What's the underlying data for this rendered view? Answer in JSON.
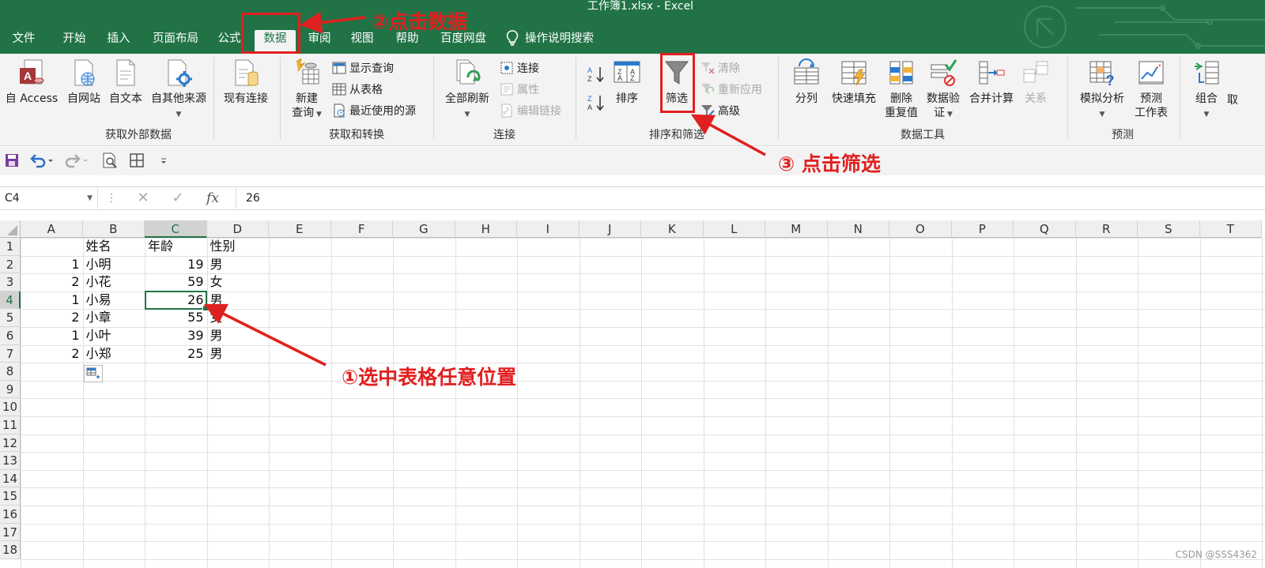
{
  "window": {
    "title": "工作簿1.xlsx  -  Excel"
  },
  "tabs": [
    {
      "label": "文件"
    },
    {
      "label": "开始"
    },
    {
      "label": "插入"
    },
    {
      "label": "页面布局"
    },
    {
      "label": "公式"
    },
    {
      "label": "数据",
      "active": true
    },
    {
      "label": "审阅"
    },
    {
      "label": "视图"
    },
    {
      "label": "帮助"
    },
    {
      "label": "百度网盘"
    },
    {
      "label": "操作说明搜索"
    }
  ],
  "ribbon": {
    "get_external": {
      "label": "获取外部数据",
      "from_access": "自 Access",
      "from_web": "自网站",
      "from_text": "自文本",
      "from_other": "自其他来源",
      "existing": "现有连接"
    },
    "get_transform": {
      "label": "获取和转换",
      "new_query_1": "新建",
      "new_query_2": "查询",
      "show_queries": "显示查询",
      "from_table": "从表格",
      "recent_sources": "最近使用的源"
    },
    "connections": {
      "label": "连接",
      "refresh_all": "全部刷新",
      "connections": "连接",
      "properties": "属性",
      "edit_links": "编辑链接"
    },
    "sort_filter": {
      "label": "排序和筛选",
      "sort": "排序",
      "filter": "筛选",
      "clear": "清除",
      "reapply": "重新应用",
      "advanced": "高级"
    },
    "data_tools": {
      "label": "数据工具",
      "text_to_cols": "分列",
      "flash_fill": "快速填充",
      "remove_dup_1": "删除",
      "remove_dup_2": "重复值",
      "validation_1": "数据验",
      "validation_2": "证",
      "consolidate": "合并计算",
      "relationships": "关系"
    },
    "forecast": {
      "label": "预测",
      "what_if": "模拟分析",
      "sheet_1": "预测",
      "sheet_2": "工作表"
    },
    "outline": {
      "group": "组合",
      "ungroup_partial": "取"
    }
  },
  "formula_bar": {
    "name_box": "C4",
    "fx": "fx",
    "value": "26"
  },
  "sheet": {
    "columns": [
      "A",
      "B",
      "C",
      "D",
      "E",
      "F",
      "G",
      "H",
      "I",
      "J",
      "K",
      "L",
      "M",
      "N",
      "O",
      "P",
      "Q",
      "R",
      "S",
      "T"
    ],
    "rows": [
      "1",
      "2",
      "3",
      "4",
      "5",
      "6",
      "7",
      "8",
      "9",
      "10",
      "11",
      "12",
      "13",
      "14",
      "15",
      "16",
      "17",
      "18"
    ],
    "header": {
      "b": "姓名",
      "c": "年龄",
      "d": "性别"
    },
    "data": [
      {
        "a": "1",
        "b": "小明",
        "c": "19",
        "d": "男"
      },
      {
        "a": "2",
        "b": "小花",
        "c": "59",
        "d": "女"
      },
      {
        "a": "1",
        "b": "小易",
        "c": "26",
        "d": "男"
      },
      {
        "a": "2",
        "b": "小章",
        "c": "55",
        "d": "女"
      },
      {
        "a": "1",
        "b": "小叶",
        "c": "39",
        "d": "男"
      },
      {
        "a": "2",
        "b": "小郑",
        "c": "25",
        "d": "男"
      }
    ],
    "selected_cell": "C4"
  },
  "annotations": {
    "step1": "①选中表格任意位置",
    "step2": "②点击数据",
    "step3": "③ 点击筛选",
    "color": "#e02020"
  },
  "watermark": "CSDN @SSS4362",
  "colors": {
    "excel_green": "#217346",
    "ribbon_bg": "#f3f3f3"
  }
}
